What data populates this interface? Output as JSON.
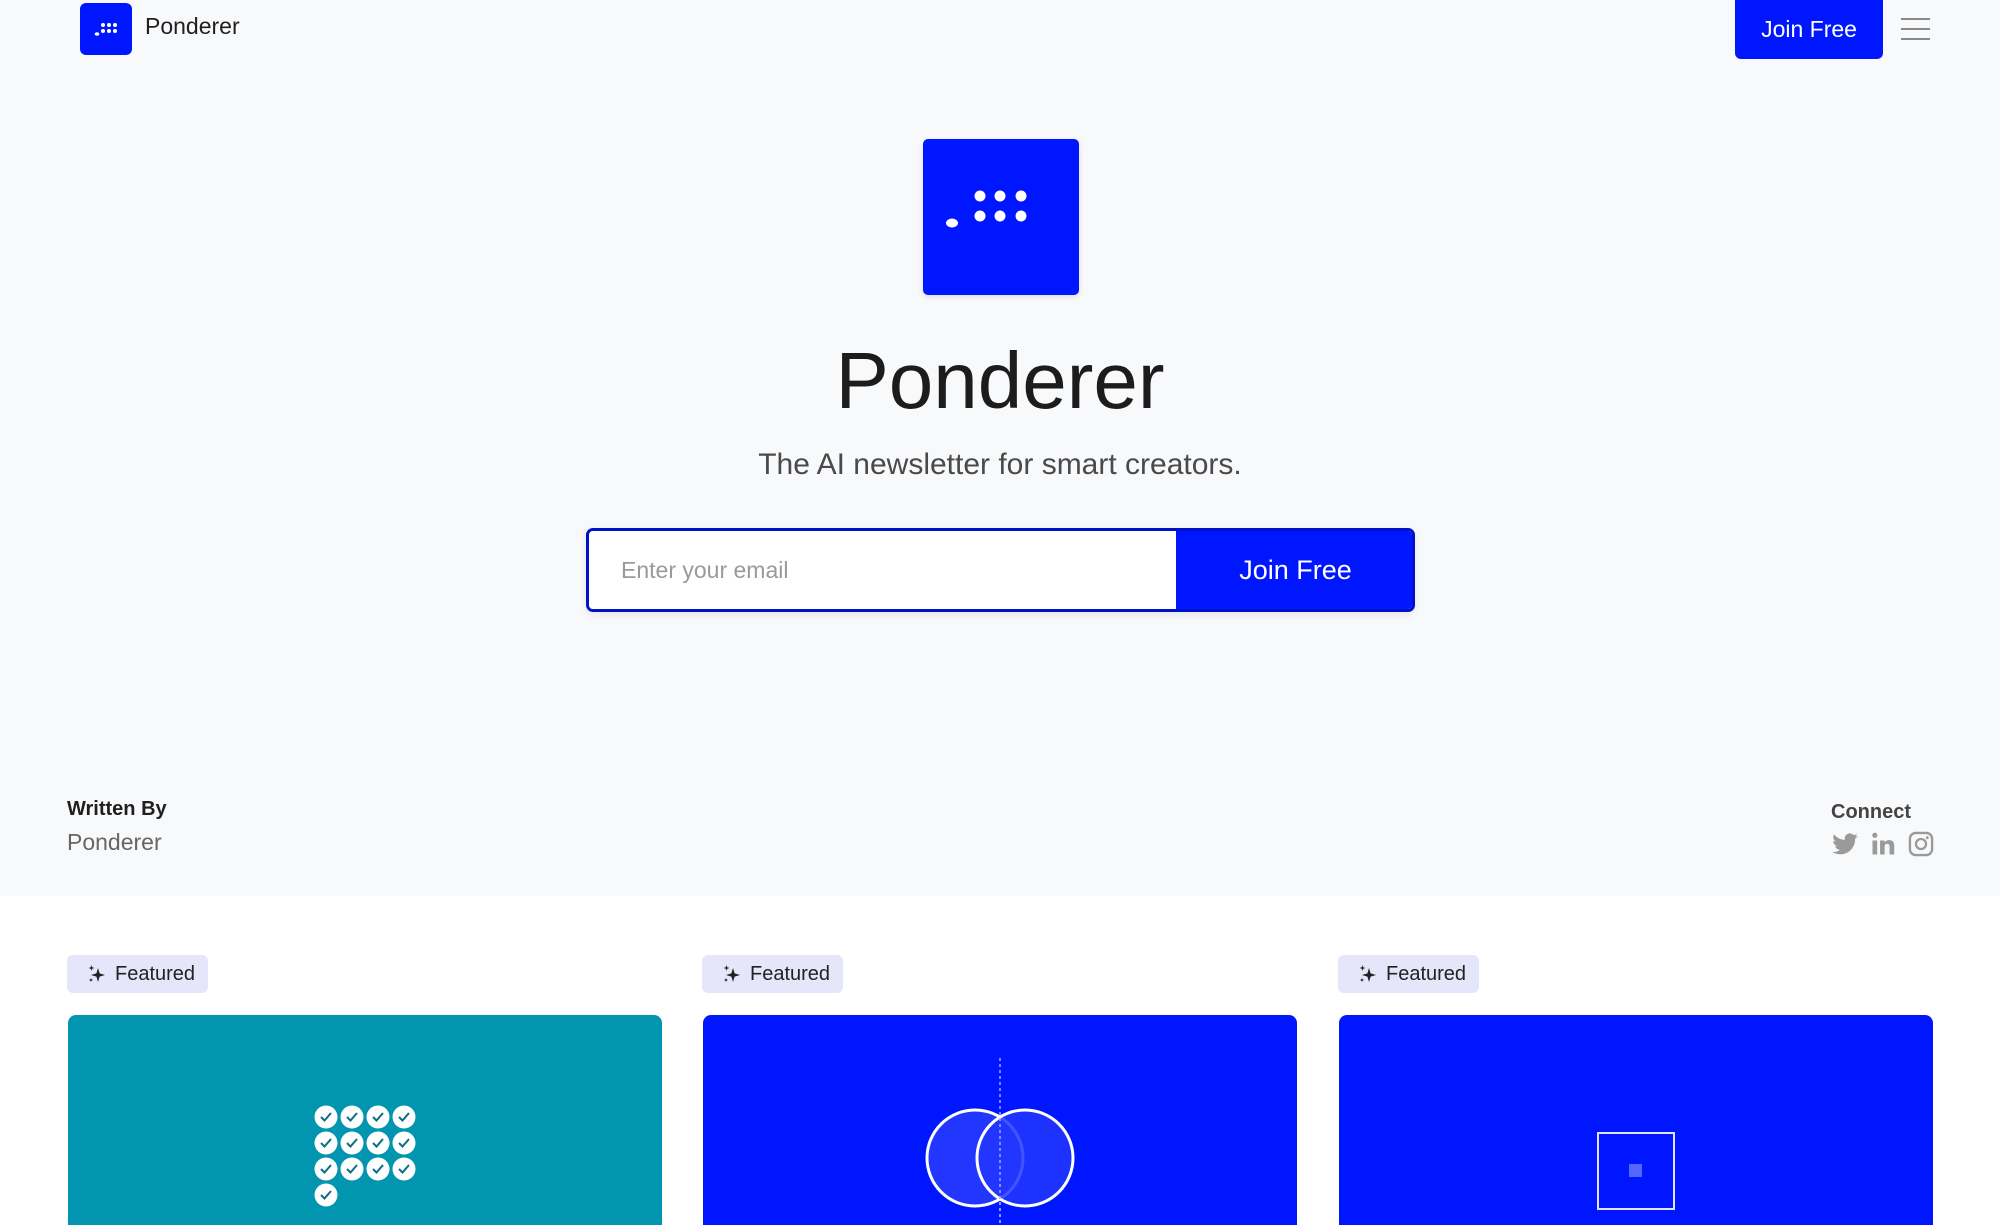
{
  "brand": {
    "name": "Ponderer",
    "accent_color": "#0016ff",
    "logo_icon": "dots-logo-icon"
  },
  "nav": {
    "title": "Ponderer",
    "join_label": "Join Free",
    "menu_icon": "hamburger-menu-icon"
  },
  "hero": {
    "title": "Ponderer",
    "subtitle": "The AI newsletter for smart creators.",
    "email_placeholder": "Enter your email",
    "email_value": "",
    "join_label": "Join Free"
  },
  "author": {
    "label": "Written By",
    "name": "Ponderer"
  },
  "connect": {
    "label": "Connect",
    "icons": [
      "twitter-icon",
      "linkedin-icon",
      "instagram-icon"
    ]
  },
  "posts": [
    {
      "badge": "Featured",
      "badge_icon": "sparkles-icon",
      "image_color": "#0295b0",
      "image_motif": "verified-badges-grid"
    },
    {
      "badge": "Featured",
      "badge_icon": "sparkles-icon",
      "image_color": "#0016ff",
      "image_motif": "venn-circles"
    },
    {
      "badge": "Featured",
      "badge_icon": "sparkles-icon",
      "image_color": "#0016ff",
      "image_motif": "square-outline"
    }
  ]
}
